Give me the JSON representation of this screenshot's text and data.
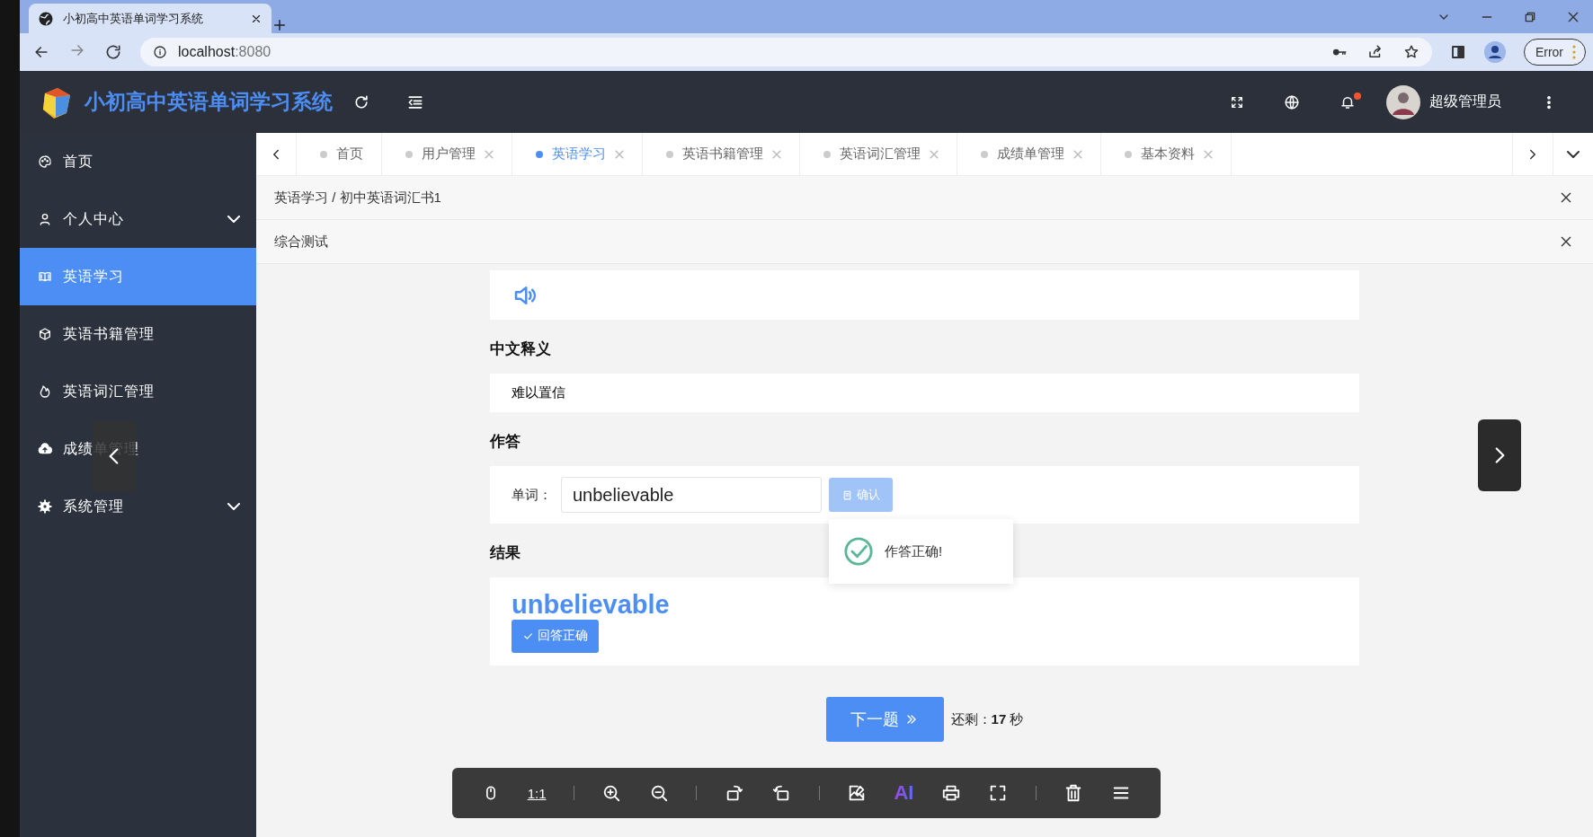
{
  "browser": {
    "tab_title": "小初高中英语单词学习系统",
    "url_host": "localhost",
    "url_port": ":8080",
    "profile_button": "Error"
  },
  "app": {
    "title": "小初高中英语单词学习系统",
    "user": "超级管理员",
    "notification_dot": true
  },
  "sidebar": {
    "items": [
      {
        "label": "首页",
        "kind": "palette",
        "selected": false,
        "expandable": false
      },
      {
        "label": "个人中心",
        "kind": "user",
        "selected": false,
        "expandable": true
      },
      {
        "label": "英语学习",
        "kind": "book",
        "selected": true,
        "expandable": false
      },
      {
        "label": "英语书籍管理",
        "kind": "cube",
        "selected": false,
        "expandable": false
      },
      {
        "label": "英语词汇管理",
        "kind": "fire",
        "selected": false,
        "expandable": false
      },
      {
        "label": "成绩单管理",
        "kind": "cloud",
        "selected": false,
        "expandable": false
      },
      {
        "label": "系统管理",
        "kind": "gear",
        "selected": false,
        "expandable": true
      }
    ]
  },
  "tabs": [
    {
      "label": "首页",
      "selected": false,
      "closable": false
    },
    {
      "label": "用户管理",
      "selected": false,
      "closable": true
    },
    {
      "label": "英语学习",
      "selected": true,
      "closable": true
    },
    {
      "label": "英语书籍管理",
      "selected": false,
      "closable": true
    },
    {
      "label": "英语词汇管理",
      "selected": false,
      "closable": true
    },
    {
      "label": "成绩单管理",
      "selected": false,
      "closable": true
    },
    {
      "label": "基本资料",
      "selected": false,
      "closable": true
    }
  ],
  "breadcrumb": "英语学习 / 初中英语词汇书1",
  "page_title": "综合测试",
  "quiz": {
    "meaning_heading": "中文释义",
    "meaning": "难以置信",
    "answer_heading": "作答",
    "word_label": "单词：",
    "answer_value": "unbelievable",
    "confirm_button": "确认",
    "confirm_disabled": true,
    "result_heading": "结果",
    "result_word": "unbelievable",
    "result_tag": "回答正确",
    "next_button": "下一题",
    "remaining_label": "还剩：",
    "remaining_value": "17",
    "remaining_unit": "秒"
  },
  "toast": {
    "message": "作答正确!"
  },
  "viewer_toolbar": {
    "ratio_button": "1:1",
    "ai_button": "AI"
  }
}
